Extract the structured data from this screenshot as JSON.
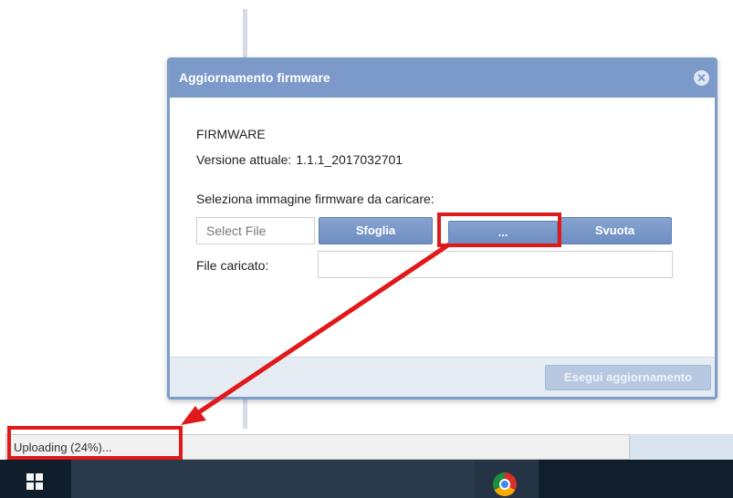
{
  "dialog": {
    "title": "Aggiornamento firmware",
    "close_symbol": "✕"
  },
  "firmware": {
    "section_title": "FIRMWARE",
    "version_label": "Versione attuale:",
    "version_value": "1.1.1_2017032701",
    "select_label": "Seleziona immagine firmware da caricare:",
    "file_placeholder": "Select File",
    "browse_label": "Sfoglia",
    "dots_label": "...",
    "clear_label": "Svuota",
    "uploaded_label": "File caricato:",
    "uploaded_value": ""
  },
  "footer": {
    "update_label": "Esegui aggiornamento"
  },
  "status": {
    "text": "Uploading (24%)..."
  },
  "taskbar": {
    "start_icon": "windows-icon",
    "browser_icon": "chrome-icon"
  },
  "colors": {
    "accent": "#7b9ac9",
    "highlight": "#e0191b"
  }
}
